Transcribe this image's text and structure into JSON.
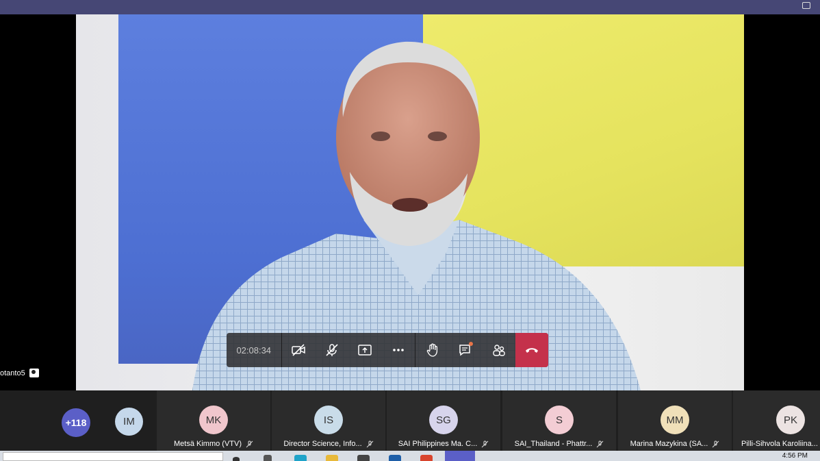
{
  "meeting": {
    "timer": "02:08:34",
    "self_label": "otanto5"
  },
  "controls": {
    "camera": "camera-off-icon",
    "mic": "mic-off-icon",
    "share": "share-screen-icon",
    "more": "more-icon",
    "raise_hand": "raise-hand-icon",
    "chat": "chat-icon",
    "participants": "participants-icon",
    "hangup": "hangup-icon"
  },
  "strip": {
    "overflow_count": "+118",
    "im_initials": "IM",
    "participants": [
      {
        "initials": "MK",
        "name": "Metsä Kimmo (VTV)",
        "color": "#f0c6cc"
      },
      {
        "initials": "IS",
        "name": "Director Science, Info...",
        "color": "#c9dce9"
      },
      {
        "initials": "SG",
        "name": "SAI Philippines Ma. C...",
        "color": "#d7d4ec"
      },
      {
        "initials": "S",
        "name": "SAI_Thailand - Phattr...",
        "color": "#f3cdd4"
      },
      {
        "initials": "MM",
        "name": "Marina Mazykina (SA...",
        "color": "#f0e0b9"
      },
      {
        "initials": "PK",
        "name": "Pilli-Sihvola Karoliina...",
        "color": "#ece3e2"
      }
    ]
  },
  "taskbar": {
    "time": "4:56 PM"
  },
  "colors": {
    "teams_purple": "#464775",
    "hangup_red": "#c4314b",
    "overflow_purple": "#5b5fc7"
  }
}
